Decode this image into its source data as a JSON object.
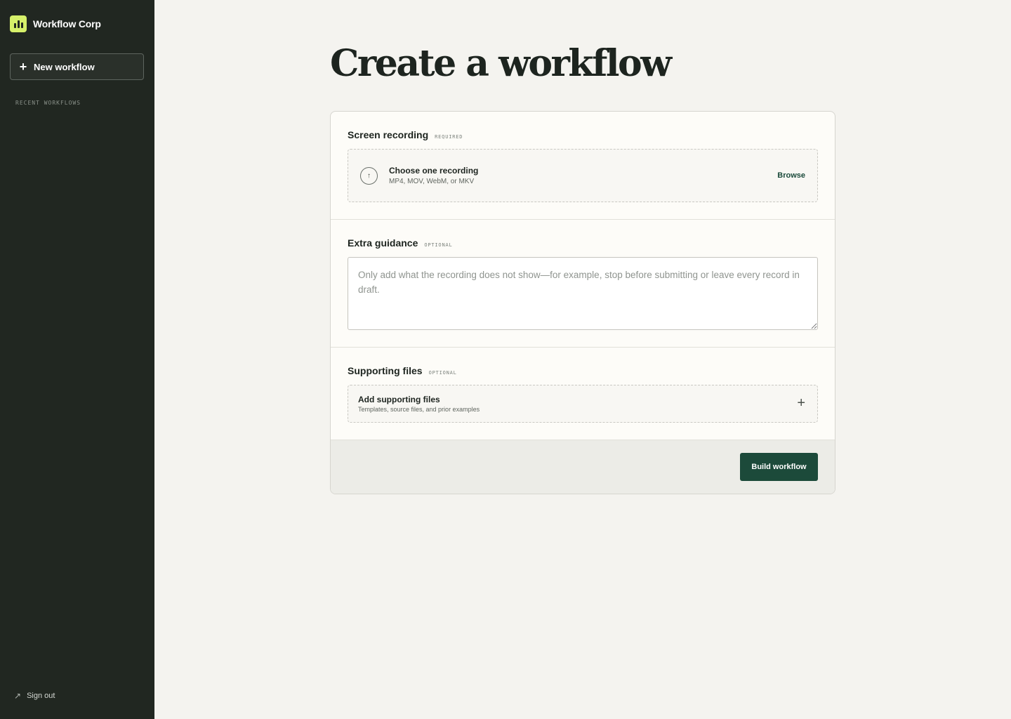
{
  "sidebar": {
    "brand_name": "Workflow Corp",
    "new_workflow_label": "New workflow",
    "recent_label": "RECENT WORKFLOWS",
    "sign_out_label": "Sign out"
  },
  "main": {
    "title": "Create a workflow",
    "recording": {
      "title": "Screen recording",
      "tag": "REQUIRED",
      "drop_title": "Choose one recording",
      "drop_sub": "MP4, MOV, WebM, or MKV",
      "browse_label": "Browse"
    },
    "guidance": {
      "title": "Extra guidance",
      "tag": "OPTIONAL",
      "placeholder": "Only add what the recording does not show—for example, stop before submitting or leave every record in draft.",
      "value": ""
    },
    "supporting": {
      "title": "Supporting files",
      "tag": "OPTIONAL",
      "drop_title": "Add supporting files",
      "drop_sub": "Templates, source files, and prior examples"
    },
    "build_label": "Build workflow"
  },
  "icons": {
    "brand": "bar-chart-icon",
    "new": "plus-icon",
    "upload": "arrow-up-icon",
    "add": "plus-icon",
    "signout": "arrow-up-right-icon"
  },
  "colors": {
    "sidebar_bg": "#212721",
    "brand_accent": "#d6f06a",
    "primary_button": "#1c4a3a",
    "page_bg": "#f4f3ef"
  }
}
